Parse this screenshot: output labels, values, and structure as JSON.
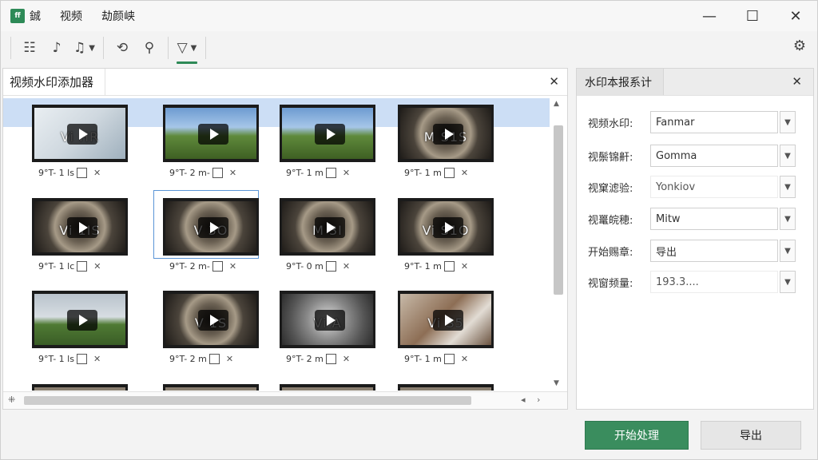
{
  "app": {
    "logo_text": "ff",
    "title": "鋮"
  },
  "menu": [
    {
      "label": "视频"
    },
    {
      "label": "劫颜峡"
    }
  ],
  "window_controls": {
    "minimize": "—",
    "maximize": "☐",
    "close": "✕"
  },
  "toolbar": {
    "buttons": [
      {
        "icon": "list-icon",
        "glyph": "☷"
      },
      {
        "icon": "music-note-icon",
        "glyph": "♪"
      },
      {
        "icon": "audio-track-icon",
        "glyph": "♫"
      },
      {
        "icon": "replace-icon",
        "glyph": "⟲"
      },
      {
        "icon": "search-icon",
        "glyph": "⚲"
      },
      {
        "icon": "filter-icon",
        "glyph": "▽"
      }
    ],
    "settings_glyph": "⚙"
  },
  "left_panel": {
    "title": "视频水印添加器",
    "close": "✕",
    "tiles": [
      {
        "text": "Vi  HR",
        "meta": "9°T- 1 ls",
        "style": "bright"
      },
      {
        "text": "",
        "meta": "9°T- 2 m-",
        "style": "field"
      },
      {
        "text": "",
        "meta": "9°T- 1 m",
        "style": "field"
      },
      {
        "text": "M  S1S",
        "meta": "9°T- 1 m",
        "style": "tunnel"
      },
      {
        "text": "Vi  1IS",
        "meta": "9°T- 1 lc",
        "style": "tunnel"
      },
      {
        "text": "V  3O",
        "meta": "9°T- 2 m-",
        "style": "tunnel"
      },
      {
        "text": "M  3I",
        "meta": "9°T- 0 m",
        "style": "tunnel"
      },
      {
        "text": "Vi  S1O",
        "meta": "9°T- 1 m",
        "style": "tunnel"
      },
      {
        "text": "",
        "meta": "9°T- 1 ls",
        "style": "park"
      },
      {
        "text": "V  1S",
        "meta": "9°T- 2 m",
        "style": "tunnel"
      },
      {
        "text": "Vi  A",
        "meta": "9°T- 2 m",
        "style": "gray"
      },
      {
        "text": "Vi  S5",
        "meta": "9°T- 1 m",
        "style": "room"
      }
    ]
  },
  "right_panel": {
    "title": "水印本报系计",
    "close": "✕",
    "fields": [
      {
        "label": "视频水印:",
        "value": "Fanmar",
        "faint": false
      },
      {
        "label": "视鬃锦鼾:",
        "value": "Gomma",
        "faint": false
      },
      {
        "label": "视窠滤验:",
        "value": "Yonkiov",
        "faint": true
      },
      {
        "label": "视鼍皖穂:",
        "value": "Mitw",
        "faint": false
      },
      {
        "label": "开始赐章:",
        "value": "导出",
        "faint": false
      },
      {
        "label": "视窗频量:",
        "value": "193.3....",
        "faint": true
      }
    ]
  },
  "buttons": {
    "start": "开始处理",
    "export": "导出"
  },
  "colors": {
    "accent": "#3a8d5e",
    "selection": "#aac8ef"
  }
}
